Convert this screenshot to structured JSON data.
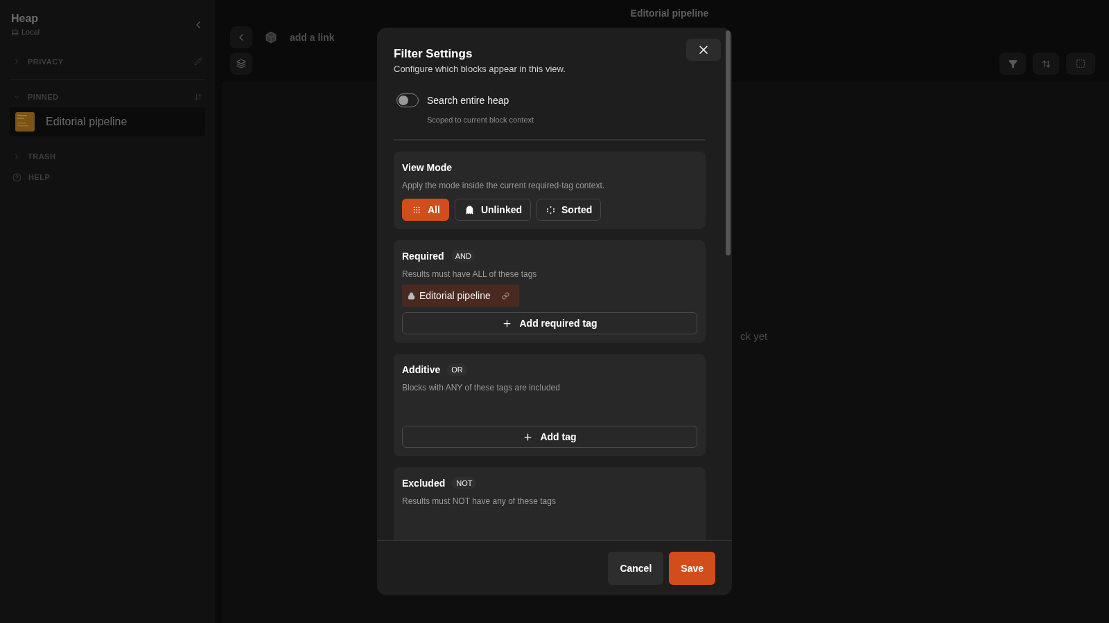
{
  "header": {
    "title": "Editorial pipeline"
  },
  "sidebar": {
    "title": "Heap",
    "location": "Local",
    "sections": [
      {
        "label": "PRIVACY",
        "expanded": false
      },
      {
        "label": "PINNED",
        "expanded": true,
        "items": [
          {
            "label": "Editorial pipeline",
            "selected": true
          }
        ]
      },
      {
        "label": "TRASH",
        "expanded": false
      }
    ],
    "help": "HELP"
  },
  "breadcrumb": {
    "text": "add a link"
  },
  "empty_state": "ck yet",
  "dialog": {
    "title": "Filter Settings",
    "subtitle": "Configure which blocks appear in this view.",
    "toggle": {
      "label": "Search entire heap",
      "note": "Scoped to current block context",
      "on": false
    },
    "view_mode": {
      "title": "View Mode",
      "description": "Apply the mode inside the current required-tag context.",
      "modes": [
        {
          "label": "All",
          "kind": "grid",
          "selected": true
        },
        {
          "label": "Unlinked",
          "kind": "ghost",
          "selected": false
        },
        {
          "label": "Sorted",
          "kind": "dots",
          "selected": false
        }
      ]
    },
    "groups": [
      {
        "title": "Required",
        "operator": "AND",
        "description": "Results must have ALL of these tags",
        "tags": [
          {
            "label": "Editorial pipeline",
            "locked": true
          }
        ],
        "add_label": "Add required tag"
      },
      {
        "title": "Additive",
        "operator": "OR",
        "description": "Blocks with ANY of these tags are included",
        "add_label": "Add tag"
      },
      {
        "title": "Excluded",
        "operator": "NOT",
        "description": "Results must NOT have any of these tags"
      }
    ],
    "buttons": {
      "cancel": "Cancel",
      "save": "Save"
    }
  }
}
